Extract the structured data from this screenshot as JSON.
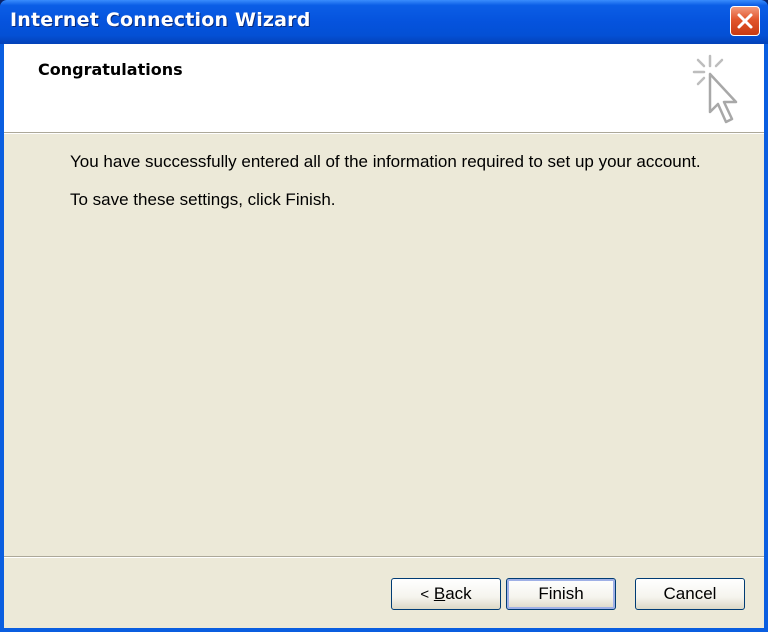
{
  "window": {
    "title": "Internet Connection Wizard"
  },
  "header": {
    "title": "Congratulations",
    "icon": "wizard-cursor-icon"
  },
  "body": {
    "line1": "You have successfully entered all of the information required to set up your account.",
    "line2": "To save these settings, click Finish."
  },
  "buttons": {
    "back_glyph": "<",
    "back_mnemonic": "B",
    "back_rest": "ack",
    "finish": "Finish",
    "cancel": "Cancel"
  },
  "colors": {
    "titlebar": "#0553dd",
    "client": "#ece9d8",
    "close": "#e2552b"
  }
}
